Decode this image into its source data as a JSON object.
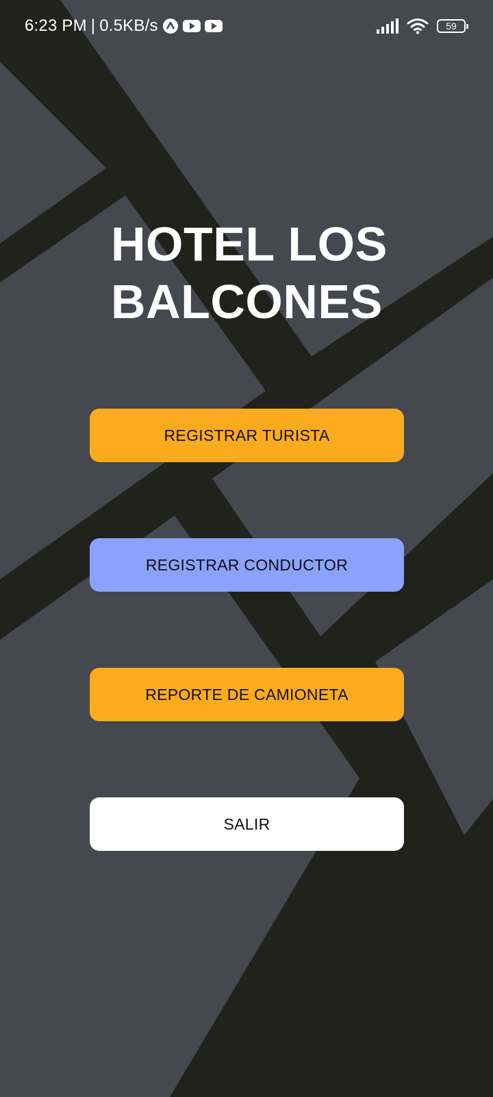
{
  "status_bar": {
    "time": "6:23 PM",
    "separator": "|",
    "net_speed": "0.5KB/s",
    "notification_icons": [
      "app-a-icon",
      "youtube-icon",
      "youtube-icon"
    ],
    "signal_icon": "signal-icon",
    "wifi_icon": "wifi-icon",
    "battery_level": "59"
  },
  "main": {
    "title_line1": "HOTEL LOS",
    "title_line2": "BALCONES",
    "buttons": [
      {
        "label": "REGISTRAR TURISTA",
        "color": "#fdab1e"
      },
      {
        "label": "REGISTRAR CONDUCTOR",
        "color": "#8ba2fc"
      },
      {
        "label": "REPORTE DE CAMIONETA",
        "color": "#fdab1e"
      },
      {
        "label": "SALIR",
        "color": "#ffffff"
      }
    ]
  },
  "colors": {
    "background_dark": "#22221d",
    "background_tile": "#45484e",
    "text_light": "#ffffff"
  }
}
